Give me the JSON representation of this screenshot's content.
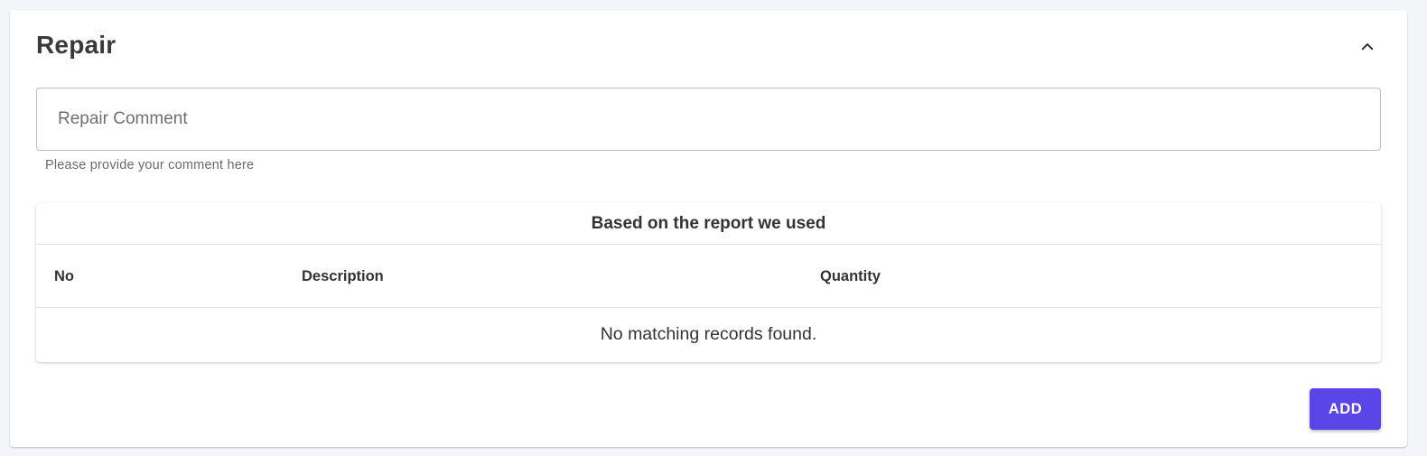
{
  "section": {
    "title": "Repair",
    "collapse_icon": "chevron-up-icon"
  },
  "comment": {
    "placeholder": "Repair Comment",
    "value": "",
    "helper_text": "Please provide your comment here"
  },
  "table": {
    "caption": "Based on the report we used",
    "columns": [
      "No",
      "Description",
      "Quantity"
    ],
    "rows": [],
    "empty_message": "No matching records found."
  },
  "actions": {
    "add_label": "ADD"
  },
  "colors": {
    "primary": "#5a45e6",
    "background": "#f4f5f9",
    "text": "#333333"
  }
}
